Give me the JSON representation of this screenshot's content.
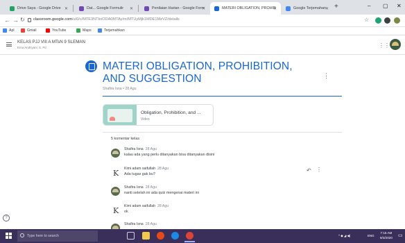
{
  "browser": {
    "tabs": [
      {
        "title": "Drive Saya - Google Drive",
        "color": "#1fa463"
      },
      {
        "title": "Dat... Google Formulir",
        "color": "#7248b9"
      },
      {
        "title": "Penilaian Harian - Google Form",
        "color": "#7248b9"
      },
      {
        "title": "MATERI OBLIGATION, PROHIB",
        "color": "#1967d2"
      },
      {
        "title": "Google Terjemahan",
        "color": "#4285f4"
      }
    ],
    "url_host": "classroom.google.com",
    "url_path": "/u/0/c/MTE3NTkxODA0MTAy/m/MTUyMjk1MDE1MzVZ/details",
    "bookmarks": [
      {
        "label": "Apl",
        "color": "#4285f4"
      },
      {
        "label": "Gmail",
        "color": "#ea4335"
      },
      {
        "label": "YouTube",
        "color": "#ff0000"
      },
      {
        "label": "Maps",
        "color": "#34a853"
      },
      {
        "label": "Terjemahkan",
        "color": "#4285f4"
      }
    ]
  },
  "classroom": {
    "class_name": "KELAS PJJ VIII A MTsN 9 SLEMAN",
    "teacher": "Erna Andriyani, S. Pd"
  },
  "material": {
    "title": "MATERI OBLIGATION, PROHIBITION, AND SUGGESTION",
    "meta": "Shafira Isna • 28 Agu",
    "attachment_title": "Obligation, Prohibition, and ...",
    "attachment_type": "Video"
  },
  "comments": {
    "count_label": "5 komentar kelas",
    "items": [
      {
        "name": "Shafira Isna",
        "date": "28 Agu",
        "text": "kalau ada yang perlu ditanyakan bisa ditanyakan disini",
        "avatar": "photo"
      },
      {
        "name": "Kimi adam saifullah",
        "date": "28 Agu",
        "text": "Ada tugas gak bu?",
        "avatar": "k"
      },
      {
        "name": "Shafira Isna",
        "date": "28 Agu",
        "text": "nanti setelah ini ada quiz mengenai materi ini",
        "avatar": "photo"
      },
      {
        "name": "Kimi adam saifullah",
        "date": "28 Agu",
        "text": "ok",
        "avatar": "k"
      },
      {
        "name": "Shafira Isna",
        "date": "28 Agu",
        "text": "",
        "avatar": "photo"
      }
    ]
  },
  "taskbar": {
    "search_placeholder": "Type here to search",
    "tray_text": "ENG",
    "time": "7:15 AM",
    "date": "9/3/2020"
  }
}
